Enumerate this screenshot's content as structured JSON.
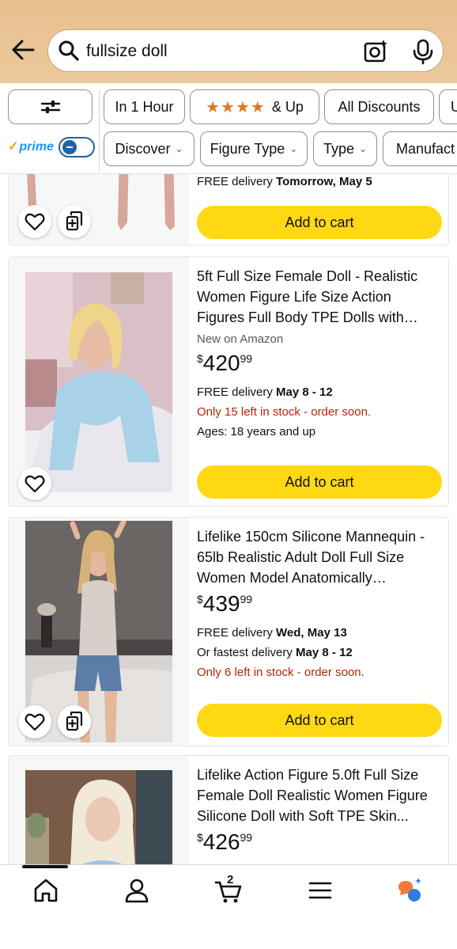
{
  "header": {
    "search_query": "fullsize doll"
  },
  "filters": {
    "row1": [
      "In 1 Hour",
      "& Up",
      "All Discounts",
      "U"
    ],
    "prime_label": "prime",
    "row2": [
      "Discover",
      "Figure Type",
      "Type",
      "Manufact"
    ]
  },
  "products": [
    {
      "delivery_prefix": "FREE delivery ",
      "delivery_date": "Tomorrow, May 5",
      "cart_label": "Add to cart"
    },
    {
      "title": "5ft Full Size Female Doll - Realistic Women Figure Life Size Action Figures Full Body TPE Dolls with Reinforced...",
      "badge": "New on Amazon",
      "price_symbol": "$",
      "price_whole": "420",
      "price_fraction": "99",
      "delivery_prefix": "FREE delivery ",
      "delivery_date": "May 8 - 12",
      "stock": "Only 15 left in stock - order soon.",
      "ages": "Ages: 18 years and up",
      "cart_label": "Add to cart"
    },
    {
      "title": "Lifelike 150cm Silicone Mannequin - 65lb Realistic Adult Doll Full Size Women Model Anatomically Accurate...",
      "price_symbol": "$",
      "price_whole": "439",
      "price_fraction": "99",
      "delivery_prefix": "FREE delivery ",
      "delivery_date": "Wed, May 13",
      "fastest_prefix": "Or fastest delivery ",
      "fastest_date": "May 8 - 12",
      "stock": "Only 6 left in stock - order soon.",
      "cart_label": "Add to cart"
    },
    {
      "title": "Lifelike Action Figure 5.0ft Full Size Female Doll Realistic Women Figure Silicone Doll with Soft TPE Skin...",
      "price_symbol": "$",
      "price_whole": "426",
      "price_fraction": "99"
    }
  ],
  "nav": {
    "cart_count": "2"
  },
  "colors": {
    "header_bg": "#e7c08e",
    "cart_button": "#ffd814",
    "stock_red": "#b12704",
    "prime_blue": "#1a98ff",
    "star_orange": "#de7921"
  }
}
